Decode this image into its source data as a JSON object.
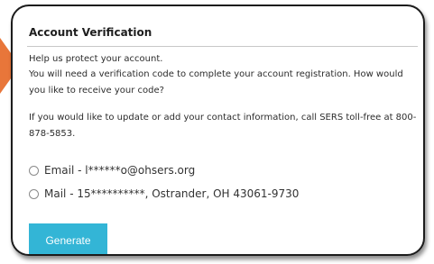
{
  "dialog": {
    "title": "Account Verification",
    "intro_line1": "Help us protect your account.",
    "intro_line2": "You will need a verification code to complete your account registration. How would you like to receive your code?",
    "contact_info": "If you would like to update or add your contact information, call SERS toll-free at 800-878-5853.",
    "options": [
      {
        "label": "Email - l******o@ohsers.org",
        "selected": false
      },
      {
        "label": "Mail - 15**********, Ostrander, OH 43061-9730",
        "selected": false
      }
    ],
    "generate_label": "Generate"
  },
  "colors": {
    "accent_button": "#33b5d6",
    "pointer_arrow": "#e8763a"
  }
}
